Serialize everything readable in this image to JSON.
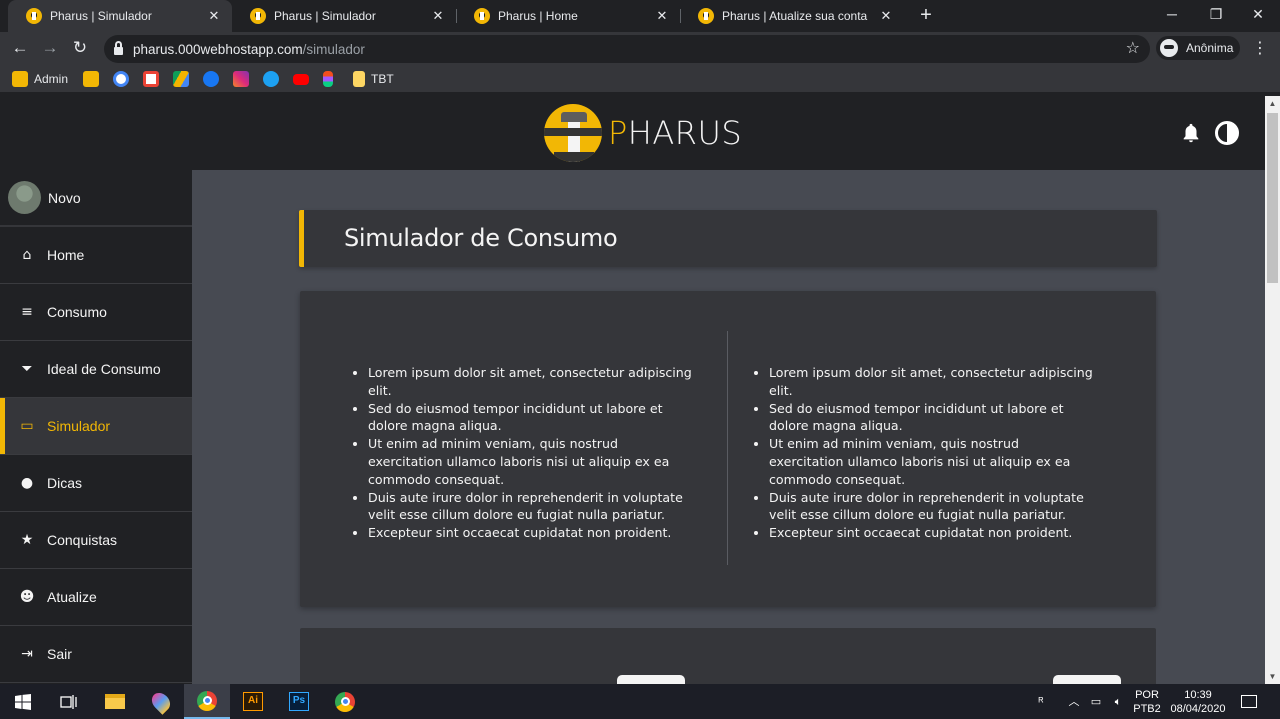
{
  "browser": {
    "tabs": [
      {
        "title": "Pharus | Simulador",
        "active": true
      },
      {
        "title": "Pharus | Simulador",
        "active": false
      },
      {
        "title": "Pharus | Home",
        "active": false
      },
      {
        "title": "Pharus | Atualize sua conta",
        "active": false
      }
    ],
    "url_host": "pharus.000webhostapp.com",
    "url_path": "/simulador",
    "profile_label": "Anônima",
    "bookmarks": [
      {
        "label": "Admin",
        "icon": "admin-icon"
      },
      {
        "label": "",
        "icon": "folder-icon"
      },
      {
        "label": "",
        "icon": "google-icon"
      },
      {
        "label": "",
        "icon": "gmail-icon"
      },
      {
        "label": "",
        "icon": "drive-icon"
      },
      {
        "label": "",
        "icon": "facebook-icon"
      },
      {
        "label": "",
        "icon": "instagram-icon"
      },
      {
        "label": "",
        "icon": "twitter-icon"
      },
      {
        "label": "",
        "icon": "youtube-icon"
      },
      {
        "label": "",
        "icon": "figma-icon"
      },
      {
        "label": "TBT",
        "icon": "folder-icon"
      }
    ]
  },
  "site": {
    "brand": {
      "first_letter": "P",
      "rest": "HARUS"
    },
    "profile": {
      "name": "Novo"
    },
    "nav": [
      {
        "label": "Home",
        "icon": "home-icon",
        "glyph": "⌂"
      },
      {
        "label": "Consumo",
        "icon": "coins-icon",
        "glyph": "≡"
      },
      {
        "label": "Ideal de Consumo",
        "icon": "filter-icon",
        "glyph": "⏷"
      },
      {
        "label": "Simulador",
        "icon": "monitor-icon",
        "glyph": "▭",
        "active": true
      },
      {
        "label": "Dicas",
        "icon": "lightbulb-icon",
        "glyph": "●"
      },
      {
        "label": "Conquistas",
        "icon": "star-icon",
        "glyph": "★"
      },
      {
        "label": "Atualize",
        "icon": "user-icon",
        "glyph": "☻"
      },
      {
        "label": "Sair",
        "icon": "sign-out-icon",
        "glyph": "⇥"
      }
    ],
    "page_title": "Simulador de Consumo",
    "columns": [
      {
        "items": [
          "Lorem ipsum dolor sit amet, consectetur adipiscing elit.",
          "Sed do eiusmod tempor incididunt ut labore et dolore magna aliqua.",
          "Ut enim ad minim veniam, quis nostrud exercitation ullamco laboris nisi ut aliquip ex ea commodo consequat.",
          "Duis aute irure dolor in reprehenderit in voluptate velit esse cillum dolore eu fugiat nulla pariatur.",
          "Excepteur sint occaecat cupidatat non proident."
        ]
      },
      {
        "items": [
          "Lorem ipsum dolor sit amet, consectetur adipiscing elit.",
          "Sed do eiusmod tempor incididunt ut labore et dolore magna aliqua.",
          "Ut enim ad minim veniam, quis nostrud exercitation ullamco laboris nisi ut aliquip ex ea commodo consequat.",
          "Duis aute irure dolor in reprehenderit in voluptate velit esse cillum dolore eu fugiat nulla pariatur.",
          "Excepteur sint occaecat cupidatat non proident."
        ]
      }
    ],
    "colors": {
      "accent": "#f2b705",
      "header_bg": "#202124",
      "page_bg": "#474a52",
      "card_bg": "#35363a"
    }
  },
  "taskbar": {
    "language": "POR",
    "layout": "PTB2",
    "time": "10:39",
    "date": "08/04/2020"
  }
}
